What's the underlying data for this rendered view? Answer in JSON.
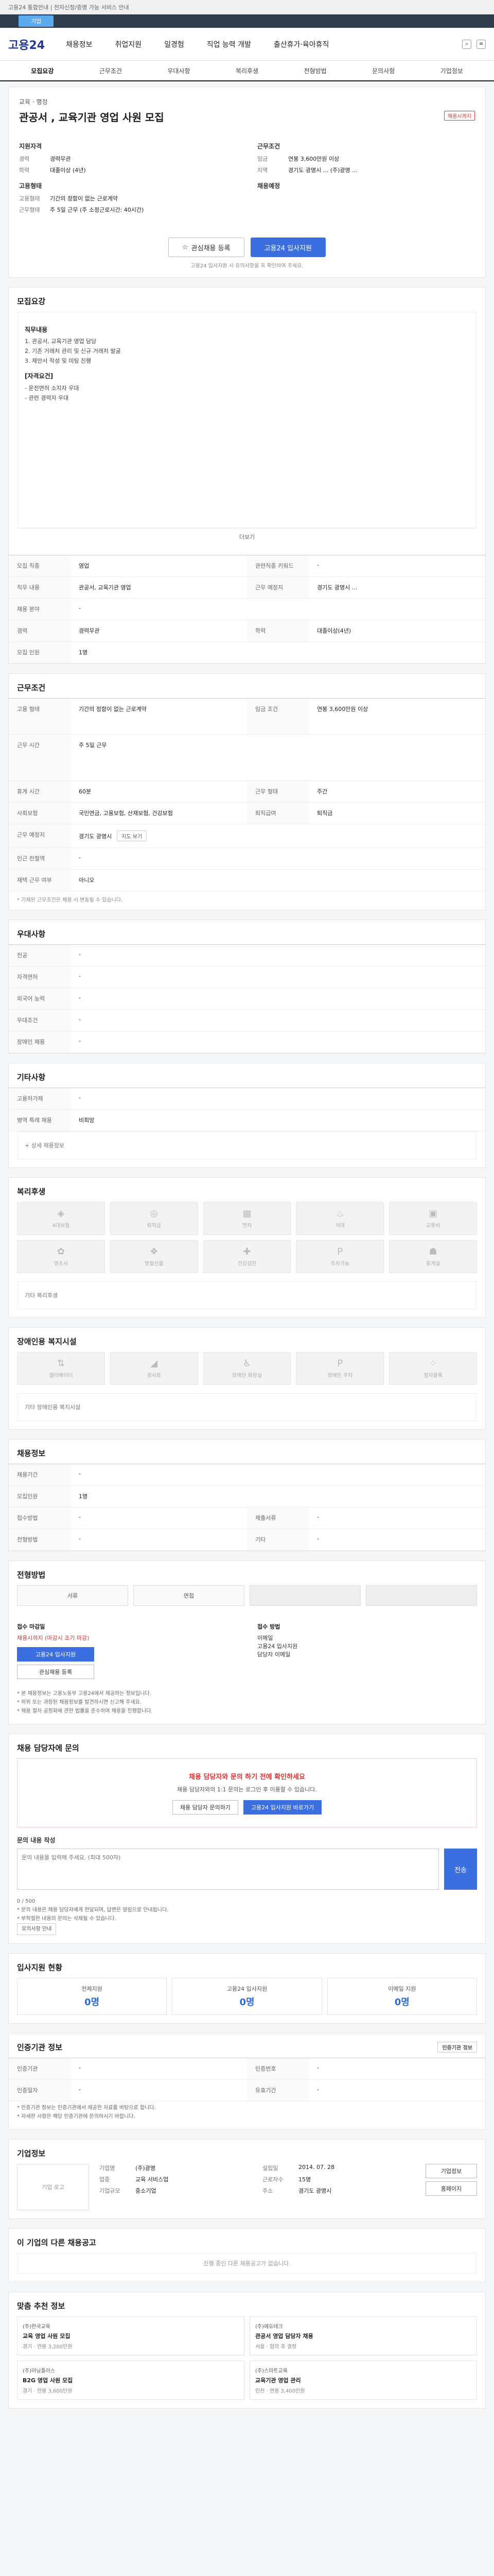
{
  "topbar": {
    "text": "고용24 통합안내 | 전자신청/증명 가능 서비스 안내"
  },
  "band": {
    "pill": "기업"
  },
  "header": {
    "logo": "고용24",
    "nav": [
      "채용정보",
      "취업지원",
      "일경험",
      "직업 능력 개발",
      "출산휴가·육아휴직"
    ]
  },
  "tabs": [
    "모집요강",
    "근무조건",
    "우대사항",
    "복리후생",
    "전형방법",
    "문의사항",
    "기업정보"
  ],
  "job": {
    "org": "교육 · 행정",
    "title": "관공서 , 교육기관 영업 사원 모집",
    "badge": "채용시까지",
    "left_title": "지원자격",
    "left": [
      {
        "k": "경력",
        "v": "경력무관"
      },
      {
        "k": "학력",
        "v": "대졸이상 (4년)"
      }
    ],
    "left_title2": "고용형태",
    "left2": [
      {
        "k": "고용형태",
        "v": "기간의 정함이 없는 근로계약"
      },
      {
        "k": "근무형태",
        "v": "주 5일 근무 (주 소정근로시간: 40시간)"
      }
    ],
    "right_title": "근무조건",
    "right": [
      {
        "k": "임금",
        "v": "연봉 3,600만원 이상"
      },
      {
        "k": "지역",
        "v": "경기도 광명시 ... (주)광명 ..."
      }
    ],
    "right_title2": "채용예정",
    "btn_outline": "관심채용 등록",
    "btn_primary": "고용24 입사지원",
    "note": "고용24 입사지원 시 유의사항을 꼭 확인하여 주세요."
  },
  "recruit": {
    "title": "모집요강",
    "box_title": "직무내용",
    "box_lines": [
      "1. 관공서, 교육기관 영업 담당",
      "2. 기존 거래처 관리 및 신규 거래처 발굴",
      "3. 제안서 작성 및 미팅 진행"
    ],
    "box_title2": "[자격요건]",
    "box_lines2": [
      "- 운전면허 소지자 우대",
      "- 관련 경력자 우대"
    ],
    "more": "더보기",
    "rows": [
      {
        "k": "모집 직종",
        "v": "영업",
        "k2": "관련직종 키워드",
        "v2": "-"
      },
      {
        "k": "직무 내용",
        "v": "관공서, 교육기관 영업",
        "k2": "근무 예정지",
        "v2": "경기도 광명시 ..."
      },
      {
        "k": "채용 분야",
        "v": "-",
        "k2": "",
        "v2": ""
      },
      {
        "k": "경력",
        "v": "경력무관",
        "k2": "학력",
        "v2": "대졸이상(4년)"
      },
      {
        "k": "모집 인원",
        "v": "1명",
        "k2": "",
        "v2": ""
      }
    ]
  },
  "work": {
    "title": "근무조건",
    "rows": [
      {
        "k": "고용 형태",
        "v": "기간의 정함이 없는 근로계약",
        "k2": "임금 조건",
        "v2": "연봉 3,600만원 이상"
      },
      {
        "k": "근무 시간",
        "v": "주 5일 근무",
        "k2": "",
        "v2": ""
      },
      {
        "k": "휴게 시간",
        "v": "60분",
        "k2": "근무 형태",
        "v2": "주간"
      },
      {
        "k": "사회보험",
        "v": "국민연금, 고용보험, 산재보험, 건강보험",
        "k2": "퇴직급여",
        "v2": "퇴직금"
      },
      {
        "k": "근무 예정지",
        "v": "경기도 광명시",
        "k2": "",
        "v2": "",
        "chip": "지도 보기"
      },
      {
        "k": "인근 전철역",
        "v": "-",
        "k2": "",
        "v2": ""
      },
      {
        "k": "재택 근무 여부",
        "v": "아니오",
        "k2": "",
        "v2": ""
      }
    ],
    "note": "* 기재된 근무조건은 채용 시 변동될 수 있습니다."
  },
  "pref": {
    "title": "우대사항",
    "rows": [
      {
        "k": "전공",
        "v": "-"
      },
      {
        "k": "자격면허",
        "v": "-"
      },
      {
        "k": "외국어 능력",
        "v": "-"
      },
      {
        "k": "우대조건",
        "v": "-"
      },
      {
        "k": "장애인 채용",
        "v": "-"
      }
    ]
  },
  "etc": {
    "title": "기타사항",
    "rows": [
      {
        "k": "고용허가제",
        "v": "-"
      },
      {
        "k": "병역 특례 채용",
        "v": "비희망"
      }
    ],
    "more": "+ 상세 채용정보"
  },
  "welfare": {
    "title": "복리후생",
    "items": [
      "4대보험",
      "퇴직금",
      "연차",
      "식대",
      "교통비",
      "경조사",
      "명절선물",
      "건강검진",
      "주차가능",
      "휴게실"
    ],
    "other_label": "기타 복리후생"
  },
  "disability": {
    "title": "장애인용 복지시설",
    "items": [
      "엘리베이터",
      "경사로",
      "장애인 화장실",
      "장애인 주차",
      "점자블록"
    ],
    "other_label": "기타 장애인용 복지시설"
  },
  "hiring": {
    "title": "채용정보",
    "rows": [
      {
        "k": "채용기간",
        "v": "-",
        "k2": "",
        "v2": ""
      },
      {
        "k": "모집인원",
        "v": "1명",
        "k2": "",
        "v2": ""
      },
      {
        "k": "접수방법",
        "v": "-",
        "k2": "제출서류",
        "v2": "-"
      },
      {
        "k": "전형방법",
        "v": "-",
        "k2": "기타",
        "v2": "-"
      }
    ]
  },
  "process": {
    "title": "전형방법",
    "steps": [
      "서류",
      "면접",
      "",
      ""
    ]
  },
  "apply": {
    "col1_title": "접수 마감일",
    "col1_val": "채용시까지 (마감시 조기 마감)",
    "col1_btns": [
      "고용24 입사지원",
      "관심채용 등록"
    ],
    "col2_title": "접수 방법",
    "col2_lines": [
      "이메일",
      "고용24 입사지원",
      "담당자 이메일"
    ],
    "bullets": [
      "* 본 채용정보는 고용노동부 고용24에서 제공하는 정보입니다.",
      "* 허위 또는 과장된 채용정보를 발견하시면 신고해 주세요.",
      "* 채용 절차 공정화에 관한 법률을 준수하여 채용을 진행합니다."
    ]
  },
  "qna": {
    "title": "채용 담당자에 문의",
    "box_title": "채용 담당자와 문의 하기 전에 확인하세요",
    "box_desc": "채용 담당자와의 1:1 문의는 로그인 후 이용할 수 있습니다.",
    "btn1": "채용 담당자 문의하기",
    "btn2": "고용24 입사지원 바로가기",
    "inq_label": "문의 내용 작성",
    "inq_placeholder": "문의 내용을 입력해 주세요. (최대 500자)",
    "send": "전송",
    "count": "0 / 500",
    "notes": [
      "* 문의 내용은 채용 담당자에게 전달되며, 답변은 알림으로 안내됩니다.",
      "* 부적절한 내용의 문의는 삭제될 수 있습니다."
    ],
    "chip": "유의사항 안내"
  },
  "stats": {
    "title": "입사지원 현황",
    "items": [
      {
        "label": "전체지원",
        "value": "0명"
      },
      {
        "label": "고용24 입사지원",
        "value": "0명"
      },
      {
        "label": "이메일 지원",
        "value": "0명"
      }
    ]
  },
  "agency": {
    "title": "인증기관 정보",
    "chip": "인증기관 정보",
    "rows": [
      {
        "k": "인증기관",
        "v": "-",
        "k2": "인증번호",
        "v2": "-"
      },
      {
        "k": "인증일자",
        "v": "-",
        "k2": "유효기간",
        "v2": "-"
      }
    ],
    "notes": [
      "* 인증기관 정보는 인증기관에서 제공한 자료를 바탕으로 합니다.",
      "* 자세한 사항은 해당 인증기관에 문의하시기 바랍니다."
    ]
  },
  "company": {
    "title": "기업정보",
    "logo": "기업 로고",
    "rows": [
      {
        "k": "기업명",
        "v": "(주)광명"
      },
      {
        "k": "업종",
        "v": "교육 서비스업"
      },
      {
        "k": "기업규모",
        "v": "중소기업"
      },
      {
        "k": "설립일",
        "v": "2014. 07. 28"
      },
      {
        "k": "근로자수",
        "v": "15명"
      },
      {
        "k": "주소",
        "v": "경기도 광명시"
      }
    ],
    "btns": [
      "기업정보",
      "홈페이지"
    ]
  },
  "others": {
    "title": "이 기업의 다른 채용공고",
    "empty": "진행 중인 다른 채용공고가 없습니다."
  },
  "recommend": {
    "title": "맞춤 추천 정보",
    "items": [
      {
        "co": "(주)한국교육",
        "title": "교육 영업 사원 모집",
        "meta": "경기 · 연봉 3,200만원"
      },
      {
        "co": "(주)에듀테크",
        "title": "관공서 영업 담당자 채용",
        "meta": "서울 · 협의 후 결정"
      },
      {
        "co": "(주)러닝플러스",
        "title": "B2G 영업 사원 모집",
        "meta": "경기 · 연봉 3,600만원"
      },
      {
        "co": "(주)스마트교육",
        "title": "교육기관 영업 관리",
        "meta": "인천 · 연봉 3,400만원"
      }
    ]
  },
  "colors": {
    "primary": "#3b6fe0",
    "accent": "#d33",
    "dark": "#2f3c4a"
  }
}
